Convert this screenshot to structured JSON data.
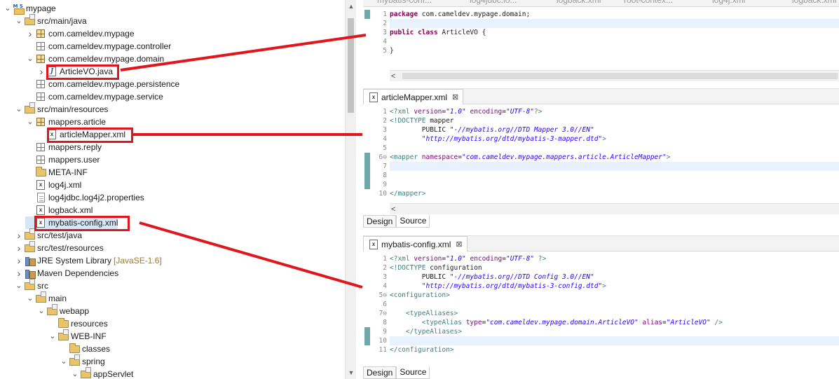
{
  "explorer": {
    "rows": [
      {
        "label": "mypage",
        "icon": "project-icon",
        "twisty": "expanded"
      },
      {
        "label": "src/main/java",
        "icon": "source-folder-icon",
        "twisty": "expanded"
      },
      {
        "label": "com.cameldev.mypage",
        "icon": "package-icon",
        "twisty": "collapsed"
      },
      {
        "label": "com.cameldev.mypage.controller",
        "icon": "package-empty-icon",
        "twisty": ""
      },
      {
        "label": "com.cameldev.mypage.domain",
        "icon": "package-icon",
        "twisty": "expanded"
      },
      {
        "label": "ArticleVO.java",
        "icon": "java-file-icon",
        "twisty": "collapsed"
      },
      {
        "label": "com.cameldev.mypage.persistence",
        "icon": "package-empty-icon",
        "twisty": ""
      },
      {
        "label": "com.cameldev.mypage.service",
        "icon": "package-empty-icon",
        "twisty": ""
      },
      {
        "label": "src/main/resources",
        "icon": "source-folder-icon",
        "twisty": "expanded"
      },
      {
        "label": "mappers.article",
        "icon": "package-icon",
        "twisty": "expanded"
      },
      {
        "label": "articleMapper.xml",
        "icon": "xml-file-icon",
        "twisty": ""
      },
      {
        "label": "mappers.reply",
        "icon": "package-empty-icon",
        "twisty": ""
      },
      {
        "label": "mappers.user",
        "icon": "package-empty-icon",
        "twisty": ""
      },
      {
        "label": "META-INF",
        "icon": "folder-icon",
        "twisty": ""
      },
      {
        "label": "log4j.xml",
        "icon": "xml-file-icon",
        "twisty": ""
      },
      {
        "label": "log4jdbc.log4j2.properties",
        "icon": "text-file-icon",
        "twisty": ""
      },
      {
        "label": "logback.xml",
        "icon": "xml-file-icon",
        "twisty": ""
      },
      {
        "label": "mybatis-config.xml",
        "icon": "xml-file-icon",
        "twisty": ""
      },
      {
        "label": "src/test/java",
        "icon": "source-folder-icon",
        "twisty": "collapsed"
      },
      {
        "label": "src/test/resources",
        "icon": "source-folder-icon",
        "twisty": "collapsed"
      },
      {
        "label": "JRE System Library",
        "suffix": "[JavaSE-1.6]",
        "icon": "library-icon",
        "twisty": "collapsed"
      },
      {
        "label": "Maven Dependencies",
        "icon": "library-icon",
        "twisty": "collapsed"
      },
      {
        "label": "src",
        "icon": "project-folder-icon",
        "twisty": "expanded"
      },
      {
        "label": "main",
        "icon": "project-folder-icon",
        "twisty": "expanded"
      },
      {
        "label": "webapp",
        "icon": "project-folder-icon",
        "twisty": "expanded"
      },
      {
        "label": "resources",
        "icon": "folder-icon",
        "twisty": ""
      },
      {
        "label": "WEB-INF",
        "icon": "project-folder-icon",
        "twisty": "expanded"
      },
      {
        "label": "classes",
        "icon": "folder-icon",
        "twisty": ""
      },
      {
        "label": "spring",
        "icon": "project-folder-icon",
        "twisty": "expanded"
      },
      {
        "label": "appServlet",
        "icon": "project-folder-icon",
        "twisty": "expanded"
      }
    ]
  },
  "top_editor": {
    "tabs": [
      "mybatis-conf...",
      "log4jdbc.lo...",
      "logback.xml",
      "root-contex...",
      "log4j.xml",
      "logback.xml"
    ],
    "lines": [
      {
        "n": "1",
        "text": "package com.cameldev.mypage.domain;"
      },
      {
        "n": "2",
        "text": ""
      },
      {
        "n": "3",
        "text": "public class ArticleVO {"
      },
      {
        "n": "4",
        "text": ""
      },
      {
        "n": "5",
        "text": "}"
      }
    ],
    "scroll_arrow": "<"
  },
  "mapper_editor": {
    "title": "articleMapper.xml",
    "close": "⊠",
    "lines": [
      {
        "n": "1",
        "text": "<?xml version=\"1.0\" encoding=\"UTF-8\"?>"
      },
      {
        "n": "2",
        "text": "<!DOCTYPE mapper"
      },
      {
        "n": "3",
        "text": "        PUBLIC \"-//mybatis.org//DTD Mapper 3.0//EN\""
      },
      {
        "n": "4",
        "text": "        \"http://mybatis.org/dtd/mybatis-3-mapper.dtd\">"
      },
      {
        "n": "5",
        "text": ""
      },
      {
        "n": "6⊖",
        "text": "<mapper namespace=\"com.cameldev.mypage.mappers.article.ArticleMapper\">"
      },
      {
        "n": "7",
        "text": ""
      },
      {
        "n": "8",
        "text": ""
      },
      {
        "n": "9",
        "text": ""
      },
      {
        "n": "10",
        "text": "</mapper>"
      }
    ],
    "scroll_arrow": "<",
    "bottom_tabs": [
      "Design",
      "Source"
    ]
  },
  "config_editor": {
    "title": "mybatis-config.xml",
    "close": "⊠",
    "lines": [
      {
        "n": "1",
        "text": "<?xml version=\"1.0\" encoding=\"UTF-8\" ?>"
      },
      {
        "n": "2",
        "text": "<!DOCTYPE configuration"
      },
      {
        "n": "3",
        "text": "        PUBLIC \"-//mybatis.org//DTD Config 3.0//EN\""
      },
      {
        "n": "4",
        "text": "        \"http://mybatis.org/dtd/mybatis-3-config.dtd\">"
      },
      {
        "n": "5⊖",
        "text": "<configuration>"
      },
      {
        "n": "6",
        "text": ""
      },
      {
        "n": "7⊖",
        "text": "    <typeAliases>"
      },
      {
        "n": "8",
        "text": "        <typeAlias type=\"com.cameldev.mypage.domain.ArticleVO\" alias=\"ArticleVO\" />"
      },
      {
        "n": "9",
        "text": "    </typeAliases>"
      },
      {
        "n": "10",
        "text": ""
      },
      {
        "n": "11",
        "text": "</configuration>"
      }
    ],
    "bottom_tabs": [
      "Design",
      "Source"
    ]
  },
  "colors": {
    "annotation_red": "#e0161e",
    "selection": "#d7e6f7",
    "keyword": "#7f0055",
    "xml_tag": "#3f7f7f",
    "xml_attr": "#7f007f",
    "xml_string": "#2a00ff"
  }
}
